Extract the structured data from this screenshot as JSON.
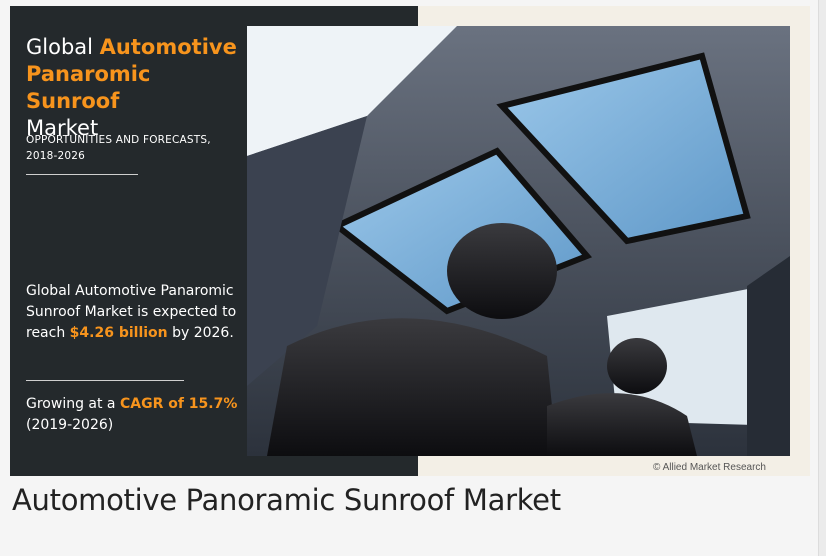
{
  "infographic": {
    "title": {
      "part1": "Global ",
      "highlight1": "Automotive",
      "highlight2": "Panaromic Sunroof",
      "part2": "Market"
    },
    "subtitle": {
      "line1": "OPPORTUNITIES AND FORECASTS,",
      "line2": "2018-2026"
    },
    "stat_market": {
      "text_before": "Global Automotive Panaromic Sunroof Market is expected to reach ",
      "value": "$4.26 billion",
      "text_after": " by 2026."
    },
    "stat_cagr": {
      "text_before": "Growing at a ",
      "value": "CAGR of 15.7%",
      "text_after": "(2019-2026)"
    },
    "copyright": "© Allied Market Research",
    "image_subject": "car-interior-panoramic-sunroof-photo",
    "colors": {
      "accent": "#f7941d",
      "panel": "#24292c",
      "background": "#f3efe6"
    }
  },
  "caption": "Automotive Panoramic Sunroof Market"
}
